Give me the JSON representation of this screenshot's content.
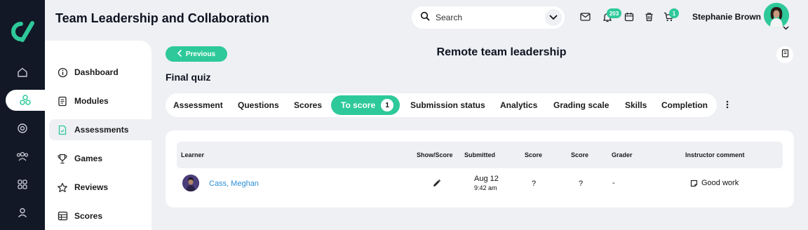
{
  "header": {
    "title": "Team Leadership and Collaboration",
    "search_placeholder": "Search",
    "notifications_count": "203",
    "cart_count": "1",
    "user_name": "Stephanie Brown"
  },
  "sidebar": {
    "items": [
      {
        "label": "Dashboard",
        "icon": "info-circle-icon"
      },
      {
        "label": "Modules",
        "icon": "document-icon"
      },
      {
        "label": "Assessments",
        "icon": "assessment-file-icon"
      },
      {
        "label": "Games",
        "icon": "trophy-icon"
      },
      {
        "label": "Reviews",
        "icon": "star-icon"
      },
      {
        "label": "Scores",
        "icon": "table-icon"
      }
    ]
  },
  "page": {
    "previous_label": "Previous",
    "title": "Remote team leadership",
    "section_title": "Final quiz"
  },
  "tabs": {
    "assessment": "Assessment",
    "questions": "Questions",
    "scores": "Scores",
    "to_score": "To score",
    "to_score_count": "1",
    "submission_status": "Submission status",
    "analytics": "Analytics",
    "grading_scale": "Grading scale",
    "skills": "Skills",
    "completion": "Completion"
  },
  "table": {
    "headers": {
      "learner": "Learner",
      "show_score": "Show/Score",
      "submitted": "Submitted",
      "score1": "Score",
      "score2": "Score",
      "grader": "Grader",
      "comment": "Instructor comment"
    },
    "rows": [
      {
        "learner": "Cass, Meghan",
        "submitted_date": "Aug 12",
        "submitted_time": "9:42 am",
        "score1": "?",
        "score2": "?",
        "grader": "-",
        "comment": "Good work"
      }
    ]
  },
  "colors": {
    "accent": "#2ec99a",
    "rail": "#121826",
    "background": "#eef0f4"
  }
}
